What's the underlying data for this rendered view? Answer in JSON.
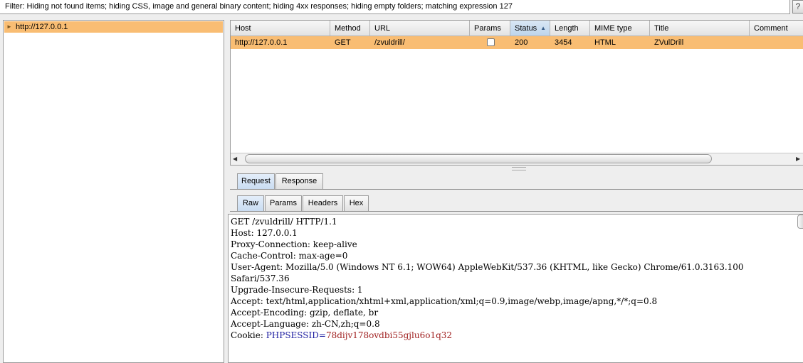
{
  "filter": {
    "text": "Filter:  Hiding not found items;  hiding CSS, image and general binary content;  hiding 4xx responses;  hiding empty folders;  matching expression 127",
    "help_label": "?"
  },
  "site_tree": {
    "selected_node": "http://127.0.0.1"
  },
  "table": {
    "columns": [
      "Host",
      "Method",
      "URL",
      "Params",
      "Status",
      "Length",
      "MIME type",
      "Title",
      "Comment"
    ],
    "sorted_column": "Status",
    "rows": [
      {
        "host": "http://127.0.0.1",
        "method": "GET",
        "url": "/zvuldrill/",
        "params": false,
        "status": "200",
        "length": "3454",
        "mime": "HTML",
        "title": "ZVulDrill",
        "comment": ""
      }
    ]
  },
  "message_tabs": [
    "Request",
    "Response"
  ],
  "message_tab_active": "Request",
  "view_tabs": [
    "Raw",
    "Params",
    "Headers",
    "Hex"
  ],
  "view_tab_active": "Raw",
  "request": {
    "lines": [
      "GET /zvuldrill/ HTTP/1.1",
      "Host: 127.0.0.1",
      "Proxy-Connection: keep-alive",
      "Cache-Control: max-age=0",
      "User-Agent: Mozilla/5.0 (Windows NT 6.1; WOW64) AppleWebKit/537.36 (KHTML, like Gecko) Chrome/61.0.3163.100",
      "Safari/537.36",
      "Upgrade-Insecure-Requests: 1",
      "Accept: text/html,application/xhtml+xml,application/xml;q=0.9,image/webp,image/apng,*/*;q=0.8",
      "Accept-Encoding: gzip, deflate, br",
      "Accept-Language: zh-CN,zh;q=0.8"
    ],
    "cookie_prefix": "Cookie: ",
    "cookie_name": "PHPSESSID",
    "cookie_eq": "=",
    "cookie_value": "78dijv178ovdbi55gjlu6o1q32"
  },
  "colors": {
    "selection": "#f9bd73",
    "cookie_name": "#1c1ca0",
    "cookie_value": "#a02020"
  }
}
